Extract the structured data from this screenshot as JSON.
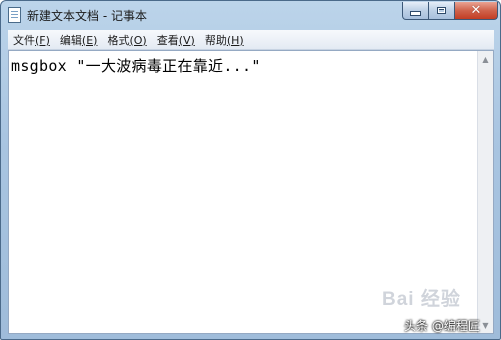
{
  "window": {
    "title": "新建文本文档 - 记事本",
    "icon": "notepad-icon"
  },
  "controls": {
    "minimize_icon": "minimize-icon",
    "maximize_icon": "maximize-icon",
    "close_icon": "close-icon",
    "close_glyph": "✕",
    "close_color": "#c23d24"
  },
  "menu": {
    "items": [
      {
        "label": "文件",
        "accel": "(F)"
      },
      {
        "label": "编辑",
        "accel": "(E)"
      },
      {
        "label": "格式",
        "accel": "(O)"
      },
      {
        "label": "查看",
        "accel": "(V)"
      },
      {
        "label": "帮助",
        "accel": "(H)"
      }
    ]
  },
  "editor": {
    "content": "msgbox \"一大波病毒正在靠近...\""
  },
  "scrollbar": {
    "up": "▲",
    "down": "▼"
  },
  "overlay": {
    "watermark": "Bai 经验",
    "attribution": "头条 @编程匠"
  }
}
